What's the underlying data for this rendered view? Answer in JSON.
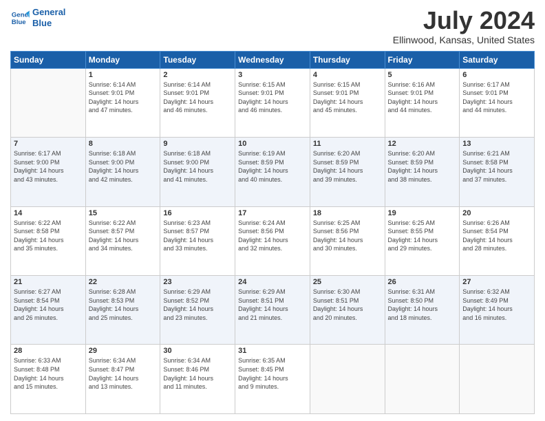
{
  "logo": {
    "line1": "General",
    "line2": "Blue"
  },
  "title": "July 2024",
  "subtitle": "Ellinwood, Kansas, United States",
  "weekdays": [
    "Sunday",
    "Monday",
    "Tuesday",
    "Wednesday",
    "Thursday",
    "Friday",
    "Saturday"
  ],
  "weeks": [
    [
      {
        "day": "",
        "info": ""
      },
      {
        "day": "1",
        "info": "Sunrise: 6:14 AM\nSunset: 9:01 PM\nDaylight: 14 hours\nand 47 minutes."
      },
      {
        "day": "2",
        "info": "Sunrise: 6:14 AM\nSunset: 9:01 PM\nDaylight: 14 hours\nand 46 minutes."
      },
      {
        "day": "3",
        "info": "Sunrise: 6:15 AM\nSunset: 9:01 PM\nDaylight: 14 hours\nand 46 minutes."
      },
      {
        "day": "4",
        "info": "Sunrise: 6:15 AM\nSunset: 9:01 PM\nDaylight: 14 hours\nand 45 minutes."
      },
      {
        "day": "5",
        "info": "Sunrise: 6:16 AM\nSunset: 9:01 PM\nDaylight: 14 hours\nand 44 minutes."
      },
      {
        "day": "6",
        "info": "Sunrise: 6:17 AM\nSunset: 9:01 PM\nDaylight: 14 hours\nand 44 minutes."
      }
    ],
    [
      {
        "day": "7",
        "info": "Sunrise: 6:17 AM\nSunset: 9:00 PM\nDaylight: 14 hours\nand 43 minutes."
      },
      {
        "day": "8",
        "info": "Sunrise: 6:18 AM\nSunset: 9:00 PM\nDaylight: 14 hours\nand 42 minutes."
      },
      {
        "day": "9",
        "info": "Sunrise: 6:18 AM\nSunset: 9:00 PM\nDaylight: 14 hours\nand 41 minutes."
      },
      {
        "day": "10",
        "info": "Sunrise: 6:19 AM\nSunset: 8:59 PM\nDaylight: 14 hours\nand 40 minutes."
      },
      {
        "day": "11",
        "info": "Sunrise: 6:20 AM\nSunset: 8:59 PM\nDaylight: 14 hours\nand 39 minutes."
      },
      {
        "day": "12",
        "info": "Sunrise: 6:20 AM\nSunset: 8:59 PM\nDaylight: 14 hours\nand 38 minutes."
      },
      {
        "day": "13",
        "info": "Sunrise: 6:21 AM\nSunset: 8:58 PM\nDaylight: 14 hours\nand 37 minutes."
      }
    ],
    [
      {
        "day": "14",
        "info": "Sunrise: 6:22 AM\nSunset: 8:58 PM\nDaylight: 14 hours\nand 35 minutes."
      },
      {
        "day": "15",
        "info": "Sunrise: 6:22 AM\nSunset: 8:57 PM\nDaylight: 14 hours\nand 34 minutes."
      },
      {
        "day": "16",
        "info": "Sunrise: 6:23 AM\nSunset: 8:57 PM\nDaylight: 14 hours\nand 33 minutes."
      },
      {
        "day": "17",
        "info": "Sunrise: 6:24 AM\nSunset: 8:56 PM\nDaylight: 14 hours\nand 32 minutes."
      },
      {
        "day": "18",
        "info": "Sunrise: 6:25 AM\nSunset: 8:56 PM\nDaylight: 14 hours\nand 30 minutes."
      },
      {
        "day": "19",
        "info": "Sunrise: 6:25 AM\nSunset: 8:55 PM\nDaylight: 14 hours\nand 29 minutes."
      },
      {
        "day": "20",
        "info": "Sunrise: 6:26 AM\nSunset: 8:54 PM\nDaylight: 14 hours\nand 28 minutes."
      }
    ],
    [
      {
        "day": "21",
        "info": "Sunrise: 6:27 AM\nSunset: 8:54 PM\nDaylight: 14 hours\nand 26 minutes."
      },
      {
        "day": "22",
        "info": "Sunrise: 6:28 AM\nSunset: 8:53 PM\nDaylight: 14 hours\nand 25 minutes."
      },
      {
        "day": "23",
        "info": "Sunrise: 6:29 AM\nSunset: 8:52 PM\nDaylight: 14 hours\nand 23 minutes."
      },
      {
        "day": "24",
        "info": "Sunrise: 6:29 AM\nSunset: 8:51 PM\nDaylight: 14 hours\nand 21 minutes."
      },
      {
        "day": "25",
        "info": "Sunrise: 6:30 AM\nSunset: 8:51 PM\nDaylight: 14 hours\nand 20 minutes."
      },
      {
        "day": "26",
        "info": "Sunrise: 6:31 AM\nSunset: 8:50 PM\nDaylight: 14 hours\nand 18 minutes."
      },
      {
        "day": "27",
        "info": "Sunrise: 6:32 AM\nSunset: 8:49 PM\nDaylight: 14 hours\nand 16 minutes."
      }
    ],
    [
      {
        "day": "28",
        "info": "Sunrise: 6:33 AM\nSunset: 8:48 PM\nDaylight: 14 hours\nand 15 minutes."
      },
      {
        "day": "29",
        "info": "Sunrise: 6:34 AM\nSunset: 8:47 PM\nDaylight: 14 hours\nand 13 minutes."
      },
      {
        "day": "30",
        "info": "Sunrise: 6:34 AM\nSunset: 8:46 PM\nDaylight: 14 hours\nand 11 minutes."
      },
      {
        "day": "31",
        "info": "Sunrise: 6:35 AM\nSunset: 8:45 PM\nDaylight: 14 hours\nand 9 minutes."
      },
      {
        "day": "",
        "info": ""
      },
      {
        "day": "",
        "info": ""
      },
      {
        "day": "",
        "info": ""
      }
    ]
  ]
}
